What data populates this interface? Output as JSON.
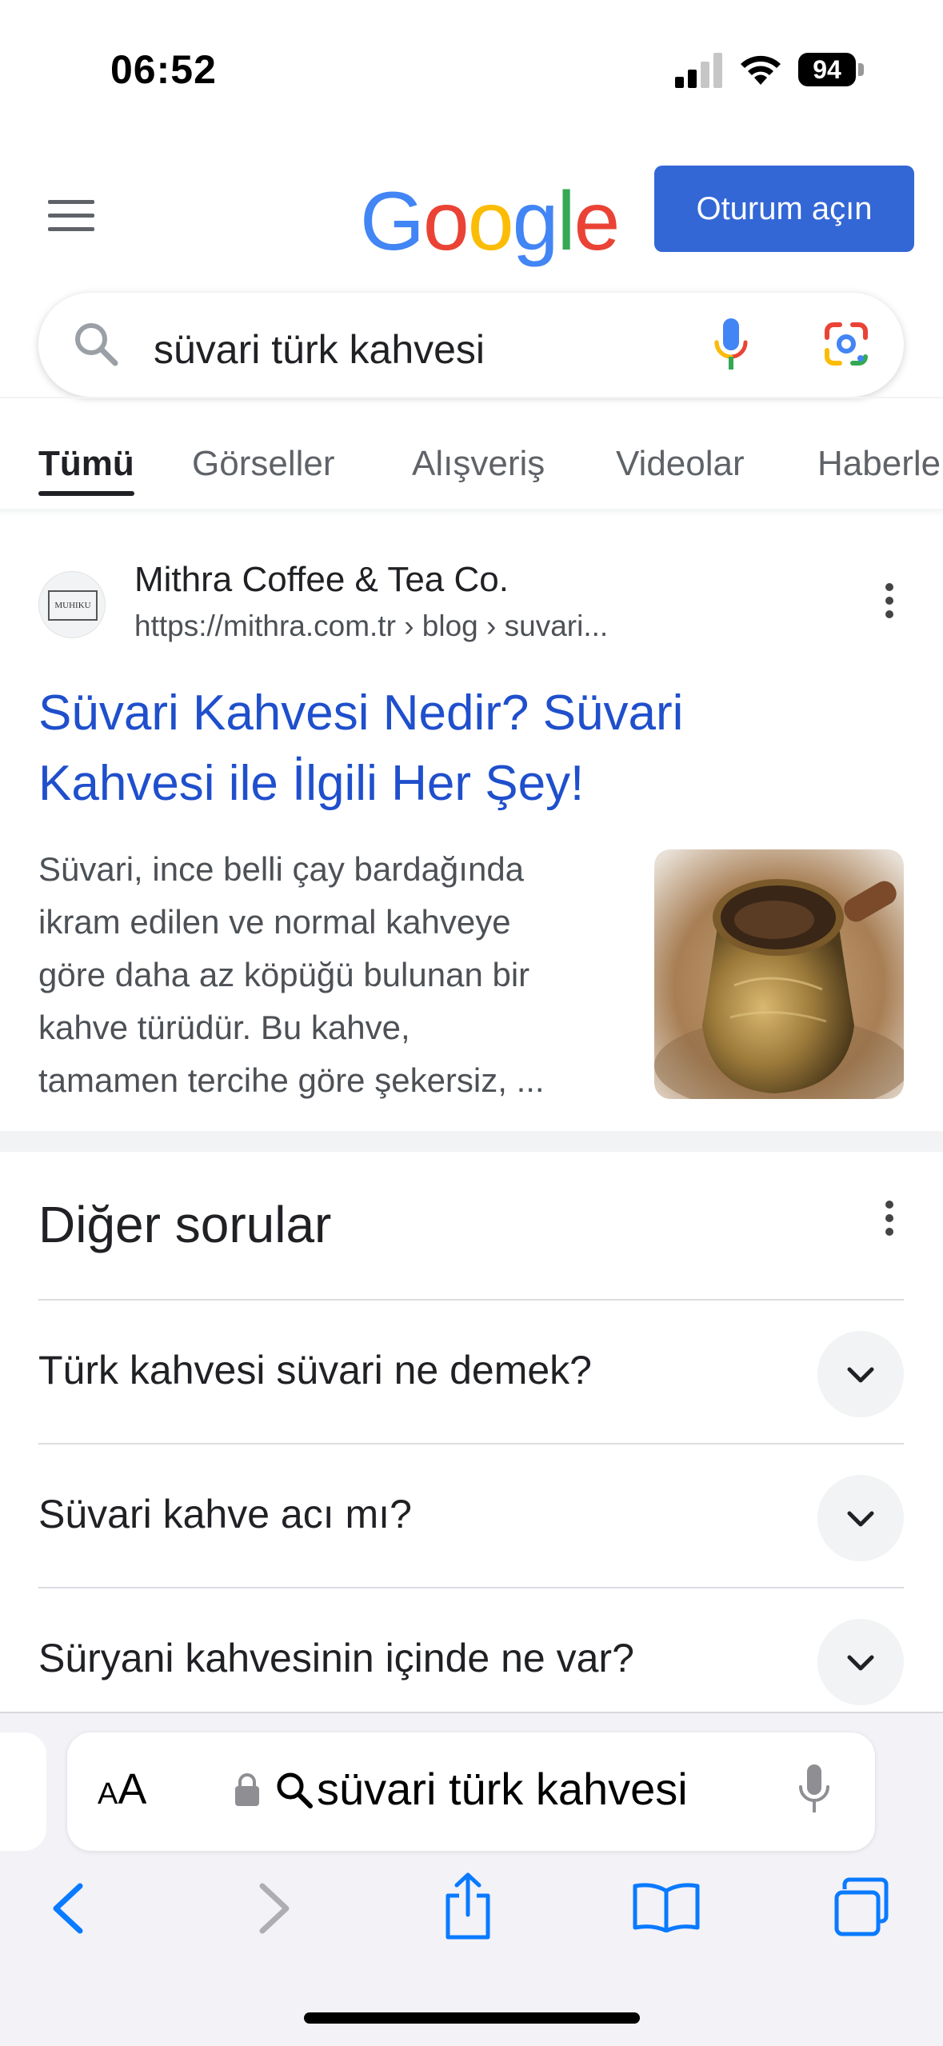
{
  "status_bar": {
    "time": "06:52",
    "battery": "94"
  },
  "header": {
    "logo": {
      "letters": [
        "G",
        "o",
        "o",
        "g",
        "l",
        "e"
      ],
      "colors": [
        "#4285F4",
        "#EA4335",
        "#FBBC05",
        "#4285F4",
        "#34A853",
        "#EA4335"
      ]
    },
    "signin_label": "Oturum açın",
    "accent": "#3367d6"
  },
  "search": {
    "query": "süvari türk kahvesi"
  },
  "tabs": [
    {
      "label": "Tümü",
      "active": true
    },
    {
      "label": "Görseller",
      "active": false
    },
    {
      "label": "Alışveriş",
      "active": false
    },
    {
      "label": "Videolar",
      "active": false
    },
    {
      "label": "Haberle",
      "active": false
    }
  ],
  "result": {
    "favicon_text": "MUHIKU",
    "site_name": "Mithra Coffee & Tea Co.",
    "url": "https://mithra.com.tr › blog › suvari...",
    "title_line1": "Süvari Kahvesi Nedir? Süvari",
    "title_line2": "Kahvesi ile İlgili Her Şey!",
    "snippet_lines": [
      "Süvari, ince belli çay bardağında",
      "ikram edilen ve normal kahveye",
      "göre daha az köpüğü bulunan bir",
      "kahve türüdür. Bu kahve,",
      "tamamen tercihe göre şekersiz, ..."
    ]
  },
  "paa": {
    "title": "Diğer sorular",
    "questions": [
      "Türk kahvesi süvari ne demek?",
      "Süvari kahve acı mı?",
      "Süryani kahvesinin içinde ne var?"
    ]
  },
  "safari": {
    "aa_small": "A",
    "aa_large": "A",
    "address_text": "süvari türk kahvesi",
    "accent": "#0a7aff"
  }
}
